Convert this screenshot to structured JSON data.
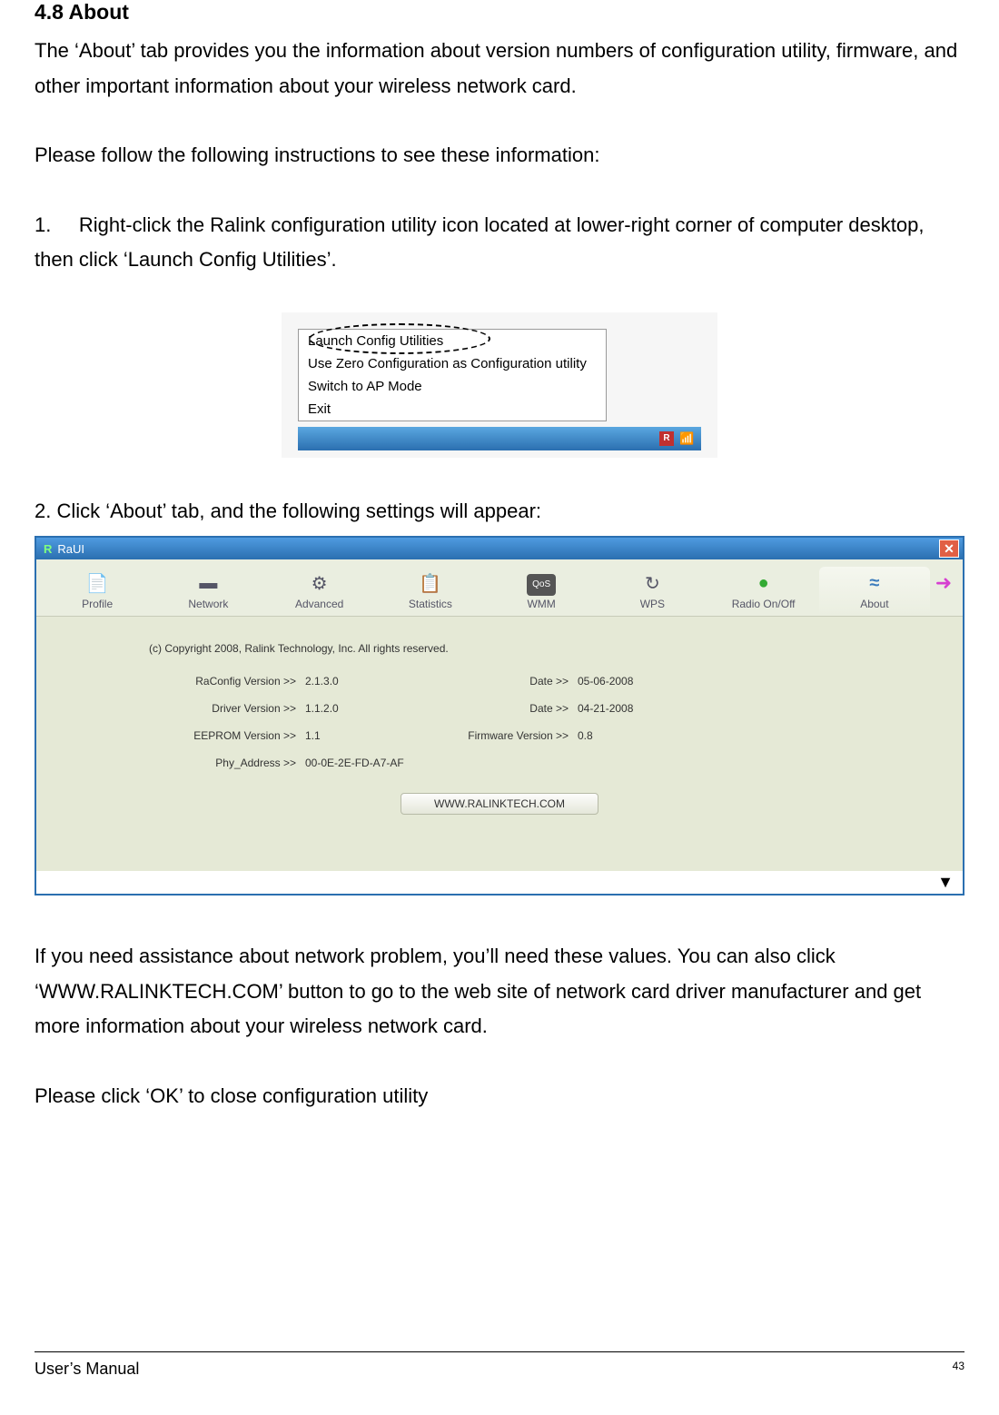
{
  "section_heading": "4.8 About",
  "para_intro": "The ‘About’ tab provides you the information about version numbers of configuration utility, firmware, and other important information about your wireless network card.",
  "para_follow": "Please follow the following instructions to see these information:",
  "step1": "1.     Right-click the Ralink configuration utility icon located at lower-right corner of computer desktop, then click ‘Launch Config Utilities’.",
  "context_menu": {
    "items": [
      "Launch Config Utilities",
      "Use Zero Configuration as Configuration utility",
      "Switch to AP Mode",
      "Exit"
    ]
  },
  "step2": "2. Click ‘About’ tab, and the following settings will appear:",
  "window": {
    "title": "RaUI",
    "tabs": [
      {
        "label": "Profile",
        "icon": "📄"
      },
      {
        "label": "Network",
        "icon": "▬"
      },
      {
        "label": "Advanced",
        "icon": "⚙"
      },
      {
        "label": "Statistics",
        "icon": "📋"
      },
      {
        "label": "WMM",
        "icon": "QoS"
      },
      {
        "label": "WPS",
        "icon": "↻"
      },
      {
        "label": "Radio On/Off",
        "icon": "●"
      },
      {
        "label": "About",
        "icon": "≈"
      }
    ],
    "copyright": "(c) Copyright 2008, Ralink Technology, Inc. All rights reserved.",
    "rows": [
      {
        "l1": "RaConfig Version >>",
        "v1": "2.1.3.0",
        "l2": "Date >>",
        "v2": "05-06-2008"
      },
      {
        "l1": "Driver Version >>",
        "v1": "1.1.2.0",
        "l2": "Date >>",
        "v2": "04-21-2008"
      },
      {
        "l1": "EEPROM Version >>",
        "v1": "1.1",
        "l2": "Firmware Version >>",
        "v2": "0.8"
      },
      {
        "l1": "Phy_Address >>",
        "v1": "00-0E-2E-FD-A7-AF",
        "l2": "",
        "v2": ""
      }
    ],
    "link_label": "WWW.RALINKTECH.COM"
  },
  "para_after": "If you need assistance about network problem, you’ll need these values. You can also click ‘WWW.RALINKTECH.COM’ button to go to the web site of network card driver manufacturer and get more information about your wireless network card.",
  "para_ok": "Please click ‘OK’ to close configuration utility",
  "footer_label": "User’s Manual",
  "page_number": "43"
}
